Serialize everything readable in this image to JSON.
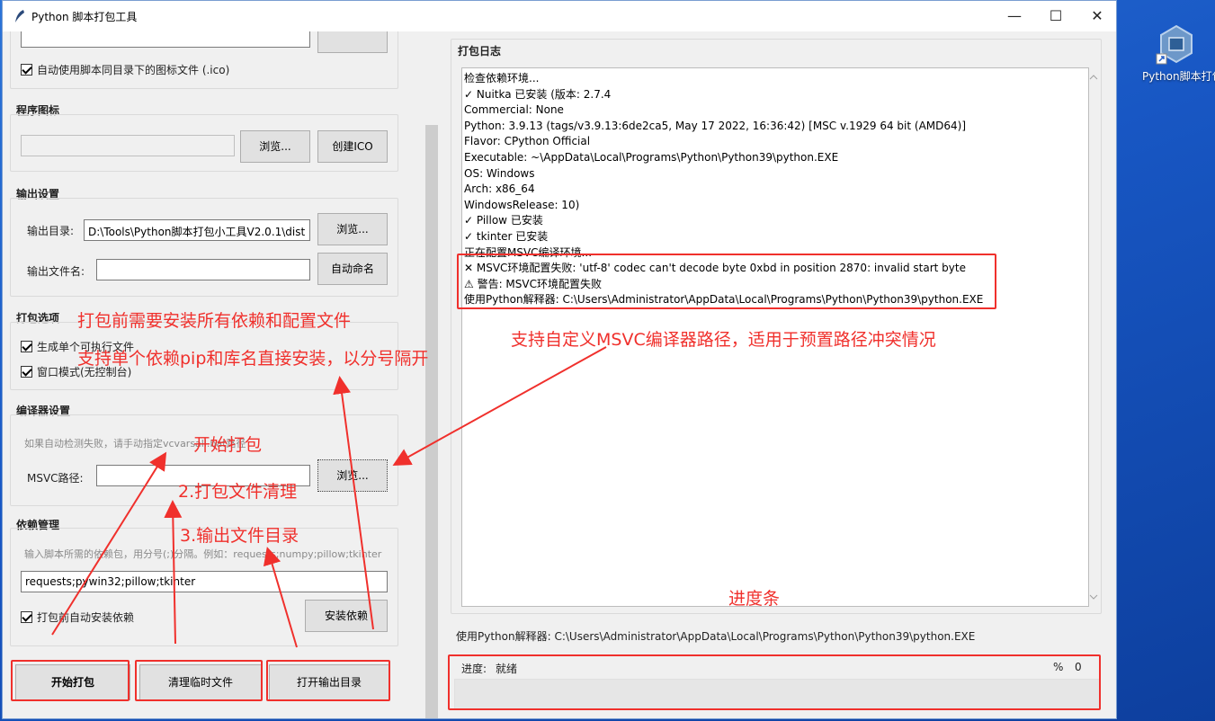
{
  "window": {
    "title": "Python 脚本打包工具"
  },
  "desktop": {
    "icon_label": "Python脚本打包小工..."
  },
  "icon_section": {
    "auto_icon_label": "自动使用脚本同目录下的图标文件 (.ico)",
    "title": "程序图标",
    "browse_label": "浏览...",
    "create_ico_label": "创建ICO"
  },
  "output": {
    "title": "输出设置",
    "dir_label": "输出目录:",
    "dir_value": "D:\\Tools\\Python脚本打包小工具V2.0.1\\dist",
    "browse_label": "浏览...",
    "filename_label": "输出文件名:",
    "filename_value": "",
    "auto_name_label": "自动命名"
  },
  "pack_options": {
    "title": "打包选项",
    "onefile_label": "生成单个可执行文件",
    "windowed_label": "窗口模式(无控制台)"
  },
  "compiler": {
    "title": "编译器设置",
    "hint": "如果自动检测失败，请手动指定vcvarsall.bat路径",
    "msvc_label": "MSVC路径:",
    "msvc_value": "",
    "browse_label": "浏览..."
  },
  "deps": {
    "title": "依赖管理",
    "hint": "输入脚本所需的依赖包，用分号(;)分隔。例如：requests;numpy;pillow;tkinter",
    "value": "requests;pywin32;pillow;tkinter",
    "auto_install_label": "打包前自动安装依赖",
    "install_label": "安装依赖"
  },
  "actions": {
    "start_label": "开始打包",
    "clean_label": "清理临时文件",
    "open_output_label": "打开输出目录"
  },
  "log": {
    "title": "打包日志",
    "lines": [
      "检查依赖环境...",
      "✓ Nuitka 已安装 (版本: 2.7.4",
      "Commercial: None",
      "Python: 3.9.13 (tags/v3.9.13:6de2ca5, May 17 2022, 16:36:42) [MSC v.1929 64 bit (AMD64)]",
      "Flavor: CPython Official",
      "Executable: ~\\AppData\\Local\\Programs\\Python\\Python39\\python.EXE",
      "OS: Windows",
      "Arch: x86_64",
      "WindowsRelease: 10)",
      "✓ Pillow 已安装",
      "✓ tkinter 已安装",
      "正在配置MSVC编译环境...",
      "✕ MSVC环境配置失败: 'utf-8' codec can't decode byte 0xbd in position 2870: invalid start byte",
      "⚠ 警告: MSVC环境配置失败",
      "使用Python解释器: C:\\Users\\Administrator\\AppData\\Local\\Programs\\Python\\Python39\\python.EXE"
    ]
  },
  "status": {
    "interpreter": "使用Python解释器: C:\\Users\\Administrator\\AppData\\Local\\Programs\\Python\\Python39\\python.EXE",
    "progress_label": "进度:",
    "progress_state": "就绪",
    "percent_sign": "%",
    "percent_value": "0",
    "progress": 0
  },
  "annotations": {
    "install_all": "打包前需要安装所有依赖和配置文件",
    "single_dep": "支持单个依赖pip和库名直接安装，以分号隔开",
    "msvc_custom": "支持自定义MSVC编译器路径，适用于预置路径冲突情况",
    "start": "开始打包",
    "clean": "2.打包文件清理",
    "open_dir": "3.输出文件目录",
    "progress": "进度条"
  },
  "colors": {
    "annotation": "#f0302c",
    "desktop": "#1b5fc9",
    "window_bg": "#f0f0f0"
  }
}
